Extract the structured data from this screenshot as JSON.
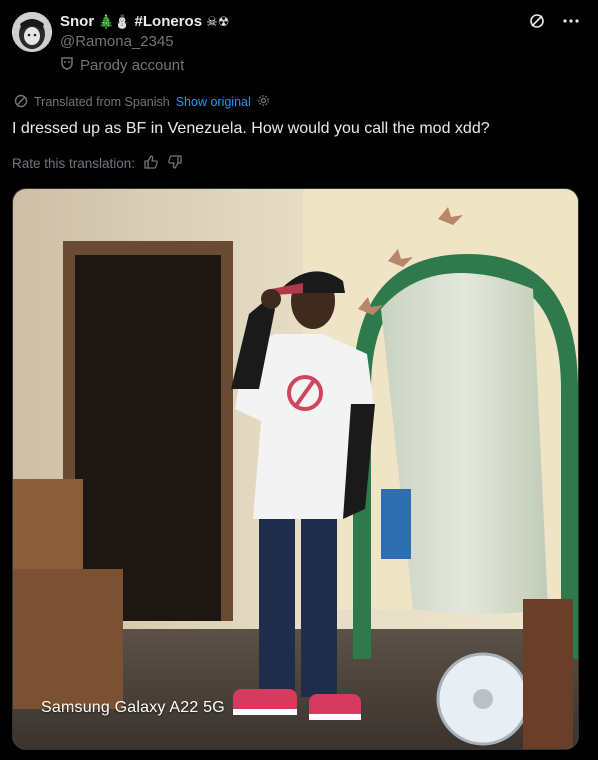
{
  "author": {
    "display_name": "Snor",
    "emoji_prefix": "🎄⛄",
    "hashtag": "#Loneros",
    "emoji_suffix": "☠☢",
    "handle": "@Ramona_2345",
    "parody_label": "Parody account"
  },
  "translation": {
    "note": "Translated from Spanish",
    "show_original": "Show original"
  },
  "tweet": {
    "text": "I dressed up as BF in Venezuela. How would you call the mod xdd?"
  },
  "rate": {
    "label": "Rate this translation:"
  },
  "media": {
    "watermark": "Samsung Galaxy A22 5G"
  },
  "colors": {
    "background": "#000000",
    "text": "#e7e9ea",
    "muted": "#71767b",
    "link": "#1d9bf0"
  },
  "icons": {
    "grok": "grok-icon",
    "more": "more-icon",
    "parody": "mask-icon",
    "translate": "translate-icon",
    "settings": "gear-icon",
    "thumb_up": "thumbs-up-icon",
    "thumb_down": "thumbs-down-icon"
  }
}
